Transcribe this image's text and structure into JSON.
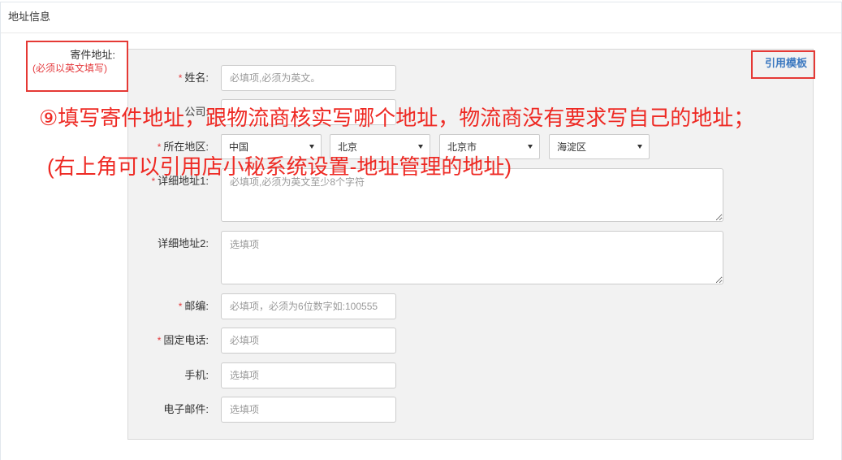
{
  "section": {
    "title": "地址信息"
  },
  "sender": {
    "label": "寄件地址:",
    "note": "(必须以英文填写)"
  },
  "template_link": {
    "label": "引用模板"
  },
  "required_mark": "*",
  "form": {
    "name": {
      "label": "姓名:",
      "required": true,
      "placeholder": "必填项,必须为英文。"
    },
    "company": {
      "label": "公司:"
    },
    "region": {
      "label": "所在地区:",
      "required": true,
      "country": "中国",
      "province": "北京",
      "city": "北京市",
      "district": "海淀区"
    },
    "address1": {
      "label": "详细地址1:",
      "required": true,
      "placeholder": "必填项,必须为英文至少8个字符"
    },
    "address2": {
      "label": "详细地址2:",
      "required": false,
      "placeholder": "选填项"
    },
    "postcode": {
      "label": "邮编:",
      "required": true,
      "placeholder": "必填项，必须为6位数字如:100555"
    },
    "phone": {
      "label": "固定电话:",
      "required": true,
      "placeholder": "必填项"
    },
    "mobile": {
      "label": "手机:",
      "required": false,
      "placeholder": "选填项"
    },
    "email": {
      "label": "电子邮件:",
      "required": false,
      "placeholder": "选填项"
    }
  },
  "annotations": {
    "step_note": "⑨填写寄件地址，跟物流商核实写哪个地址，物流商没有要求写自己的地址；",
    "template_hint": "(右上角可以引用店小秘系统设置-地址管理的地址)"
  },
  "colors": {
    "annotation": "#ee2a24",
    "highlight_box": "#e53935",
    "required": "#e4393c",
    "note": "#e4393c",
    "link": "#3b78c0",
    "panel_bg": "#f2f2f2"
  },
  "icons": {
    "select_arrow": "caret-down-icon"
  }
}
